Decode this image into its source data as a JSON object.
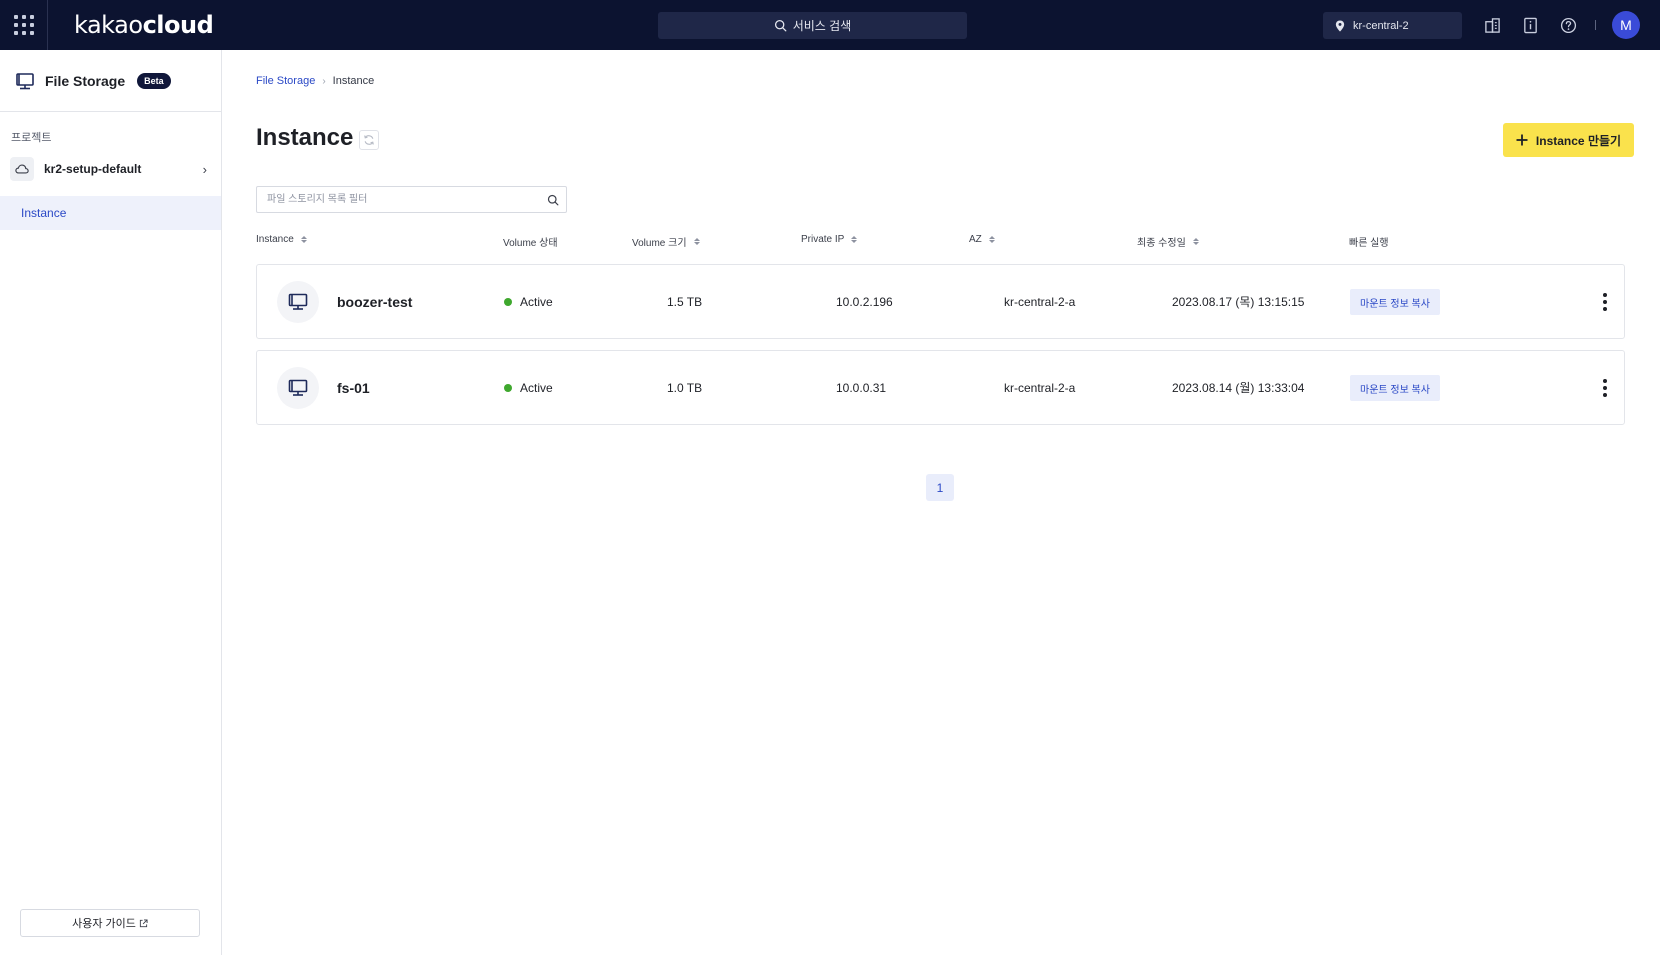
{
  "topbar": {
    "logo_light": "kakao",
    "logo_bold": "cloud",
    "search_label": "서비스 검색",
    "region": "kr-central-2",
    "avatar_initial": "M",
    "icons": [
      "grid-apps-icon",
      "building-icon",
      "notice-icon",
      "help-icon"
    ],
    "colors": {
      "background": "#0c1330",
      "avatar": "#3a4bd8"
    }
  },
  "sidebar": {
    "service_title": "File Storage",
    "badge": "Beta",
    "project_label": "프로젝트",
    "project_name": "kr2-setup-default",
    "nav_items": [
      {
        "label": "Instance",
        "active": true
      }
    ],
    "guide_label": "사용자 가이드"
  },
  "breadcrumb": {
    "root": "File Storage",
    "current": "Instance"
  },
  "main": {
    "title": "Instance",
    "create_button": "Instance 만들기",
    "filter_placeholder": "파일 스토리지 목록 필터",
    "accent_color": "#fae24c"
  },
  "table": {
    "headers": [
      "Instance",
      "Volume 상태",
      "Volume 크기",
      "Private IP",
      "AZ",
      "최종 수정일",
      "빠른 실행"
    ],
    "rows": [
      {
        "name": "boozer-test",
        "status": "Active",
        "size": "1.5 TB",
        "ip": "10.0.2.196",
        "az": "kr-central-2-a",
        "modified": "2023.08.17 (목) 13:15:15",
        "action": "마운트 정보 복사"
      },
      {
        "name": "fs-01",
        "status": "Active",
        "size": "1.0 TB",
        "ip": "10.0.0.31",
        "az": "kr-central-2-a",
        "modified": "2023.08.14 (월) 13:33:04",
        "action": "마운트 정보 복사"
      }
    ]
  },
  "pagination": {
    "current": "1"
  }
}
